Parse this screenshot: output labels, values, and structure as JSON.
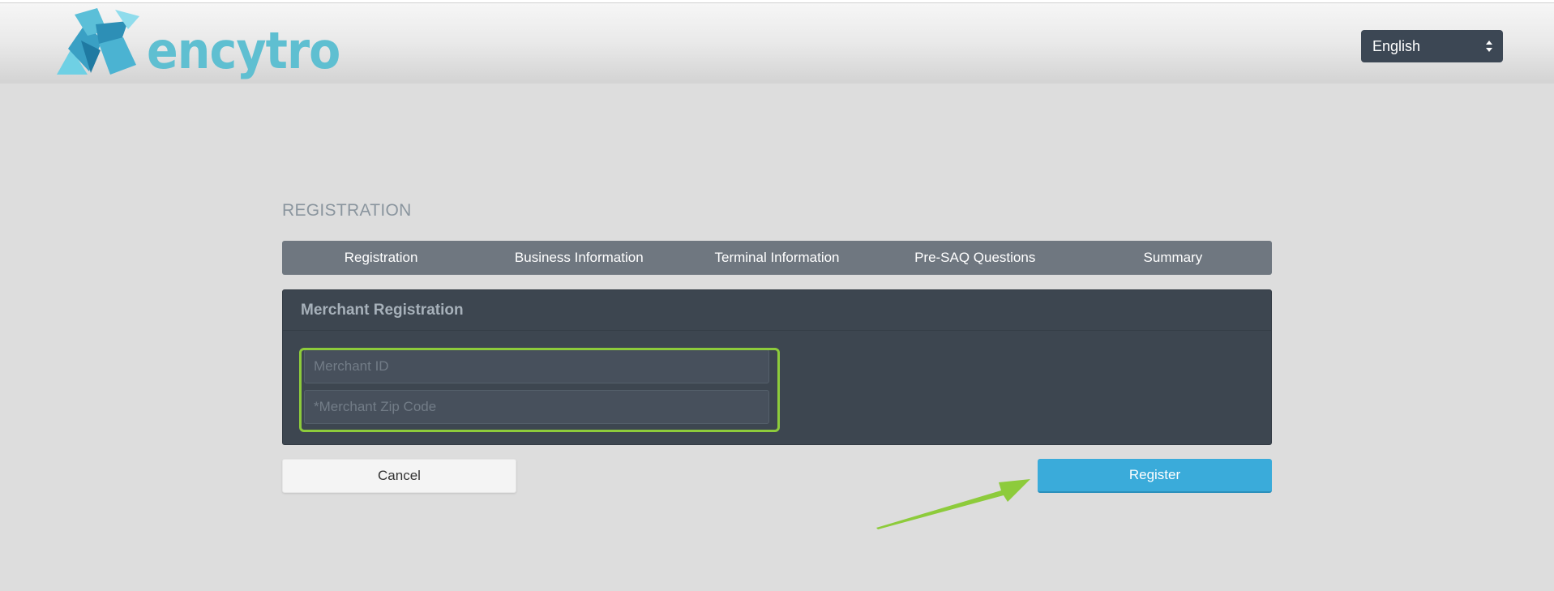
{
  "header": {
    "logo_text": "encytro",
    "language": "English"
  },
  "page": {
    "title": "REGISTRATION"
  },
  "steps": [
    {
      "label": "Registration"
    },
    {
      "label": "Business Information"
    },
    {
      "label": "Terminal Information"
    },
    {
      "label": "Pre-SAQ Questions"
    },
    {
      "label": "Summary"
    }
  ],
  "panel": {
    "title": "Merchant Registration",
    "fields": {
      "merchant_id": {
        "placeholder": "Merchant ID",
        "value": ""
      },
      "merchant_zip": {
        "placeholder": "*Merchant Zip Code",
        "value": ""
      }
    }
  },
  "buttons": {
    "cancel": "Cancel",
    "register": "Register"
  },
  "colors": {
    "accent": "#3aabda",
    "highlight": "#8dcb3b",
    "panel_bg": "#3d4650",
    "steps_bg": "#6f7780",
    "logo": "#5fbfd1"
  },
  "icons": {
    "logo_mark": "encytro-logo-mark",
    "select_arrows": "sort-updown-icon",
    "annotation": "green-arrow-annotation"
  }
}
